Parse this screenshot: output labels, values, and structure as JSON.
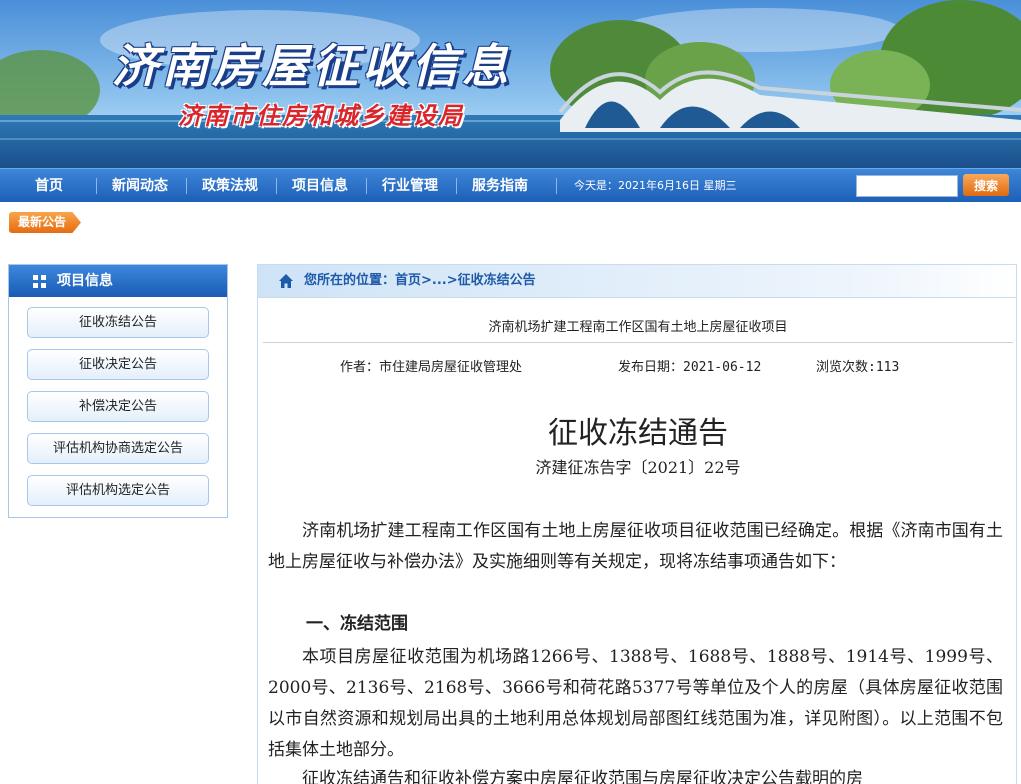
{
  "banner": {
    "title": "济南房屋征收信息",
    "subtitle": "济南市住房和城乡建设局"
  },
  "nav": {
    "items": [
      "首页",
      "新闻动态",
      "政策法规",
      "项目信息",
      "行业管理",
      "服务指南"
    ],
    "date_text": "今天是：2021年6月16日 星期三",
    "search_placeholder": "",
    "search_button": "搜索"
  },
  "notice_tab": "最新公告",
  "sidebar": {
    "title": "项目信息",
    "items": [
      "征收冻结公告",
      "征收决定公告",
      "补偿决定公告",
      "评估机构协商选定公告",
      "评估机构选定公告"
    ]
  },
  "breadcrumb": {
    "text": "您所在的位置：首页>...>征收冻结公告"
  },
  "article": {
    "project_title": "济南机场扩建工程南工作区国有土地上房屋征收项目",
    "author": "作者：市住建局房屋征收管理处",
    "date": "发布日期：2021-06-12",
    "views": "浏览次数:113",
    "doc_title": "征收冻结通告",
    "doc_number": "济建征冻告字〔2021〕22号",
    "para1": "济南机场扩建工程南工作区国有土地上房屋征收项目征收范围已经确定。根据《济南市国有土地上房屋征收与补偿办法》及实施细则等有关规定，现将冻结事项通告如下：",
    "heading1": "一、冻结范围",
    "para2": "本项目房屋征收范围为机场路1266号、1388号、1688号、1888号、1914号、1999号、2000号、2136号、2168号、3666号和荷花路5377号等单位及个人的房屋（具体房屋征收范围以市自然资源和规划局出具的土地利用总体规划局部图红线范围为准，详见附图）。以上范围不包括集体土地部分。",
    "para3": "征收冻结通告和征收补偿方案中房屋征收范围与房屋征收决定公告载明的房"
  }
}
